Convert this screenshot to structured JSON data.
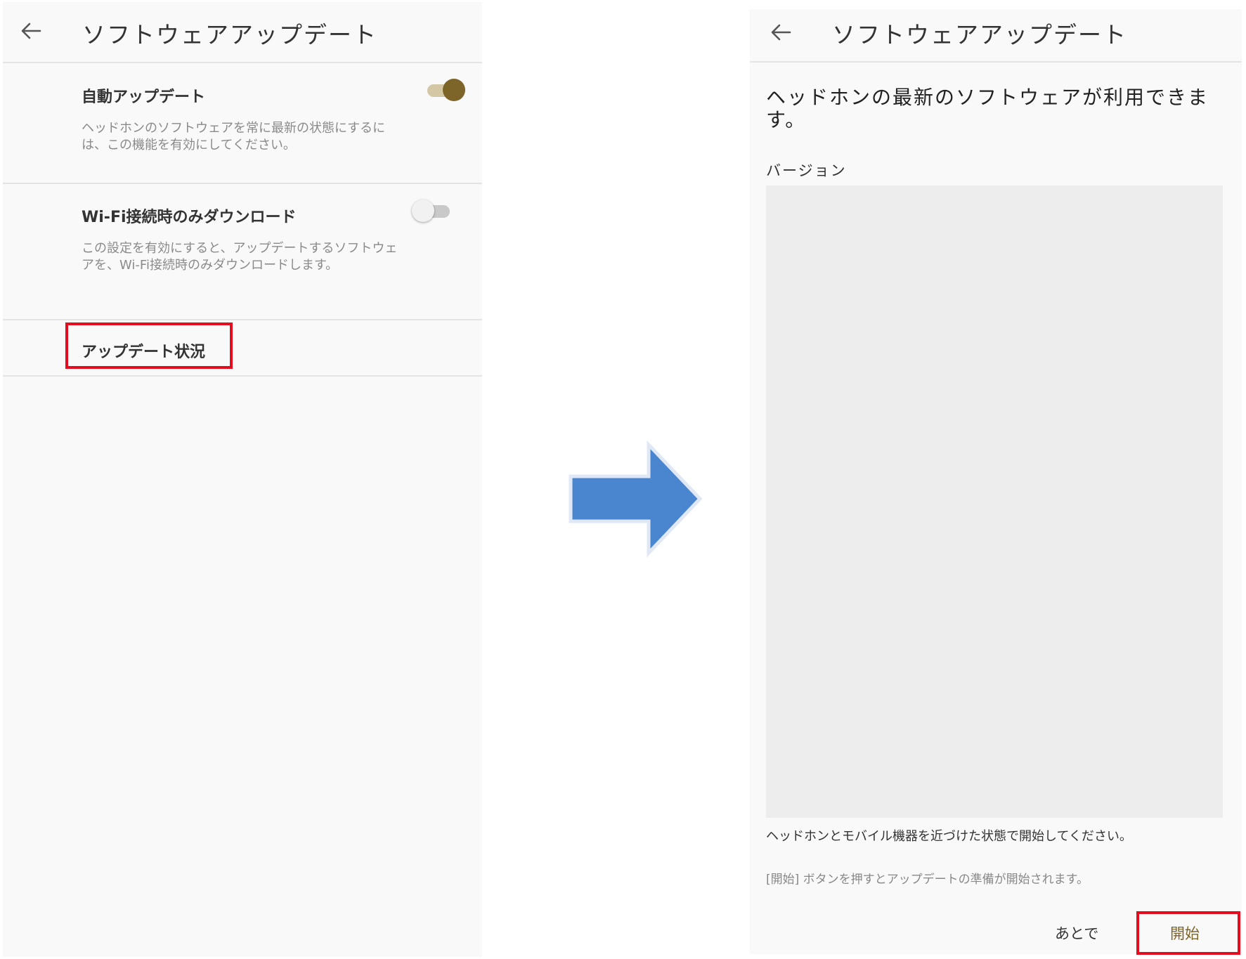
{
  "left_screen": {
    "title": "ソフトウェアアップデート",
    "auto_update": {
      "title": "自動アップデート",
      "description": "ヘッドホンのソフトウェアを常に最新の状態にするには、この機能を有効にしてください。",
      "toggle": "on"
    },
    "wifi_only": {
      "title": "Wi-Fi接続時のみダウンロード",
      "description": "この設定を有効にすると、アップデートするソフトウェアを、Wi-Fi接続時のみダウンロードします。",
      "toggle": "off"
    },
    "update_status": {
      "title": "アップデート状況"
    }
  },
  "right_screen": {
    "title": "ソフトウェアアップデート",
    "message": "ヘッドホンの最新のソフトウェアが利用できます。",
    "version_label": "バージョン",
    "instruction": "ヘッドホンとモバイル機器を近づけた状態で開始してください。",
    "note": "[開始] ボタンを押すとアップデートの準備が開始されます。",
    "later_label": "あとで",
    "start_label": "開始"
  },
  "colors": {
    "accent": "#7d6428",
    "highlight": "#e30d1f",
    "arrow": "#4a86d0"
  }
}
